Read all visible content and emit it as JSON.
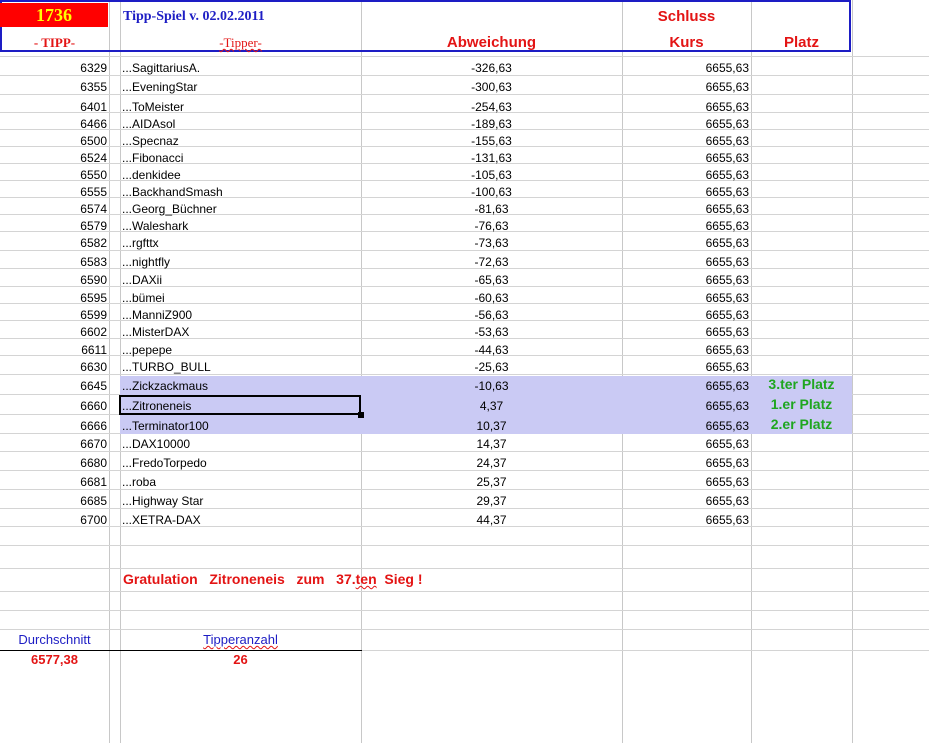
{
  "header": {
    "badge_number": "1736",
    "title": "Tipp-Spiel v. 02.02.2011",
    "col_tipp": "- TIPP-",
    "col_tipper": "-Tipper-",
    "col_abweichung": "Abweichung",
    "col_schluss": "Schluss",
    "col_kurs": "Kurs",
    "col_platz": "Platz"
  },
  "rows": [
    {
      "tipp": "6329",
      "tipper": "...SagittariusA.",
      "abw": "-326,63",
      "kurs": "6655,63",
      "platz": ""
    },
    {
      "tipp": "6355",
      "tipper": "...EveningStar",
      "abw": "-300,63",
      "kurs": "6655,63",
      "platz": ""
    },
    {
      "tipp": "6401",
      "tipper": "...ToMeister",
      "abw": "-254,63",
      "kurs": "6655,63",
      "platz": ""
    },
    {
      "tipp": "6466",
      "tipper": "...AIDAsol",
      "abw": "-189,63",
      "kurs": "6655,63",
      "platz": ""
    },
    {
      "tipp": "6500",
      "tipper": "...Specnaz",
      "abw": "-155,63",
      "kurs": "6655,63",
      "platz": ""
    },
    {
      "tipp": "6524",
      "tipper": "...Fibonacci",
      "abw": "-131,63",
      "kurs": "6655,63",
      "platz": ""
    },
    {
      "tipp": "6550",
      "tipper": "...denkidee",
      "abw": "-105,63",
      "kurs": "6655,63",
      "platz": ""
    },
    {
      "tipp": "6555",
      "tipper": "...BackhandSmash",
      "abw": "-100,63",
      "kurs": "6655,63",
      "platz": ""
    },
    {
      "tipp": "6574",
      "tipper": "...Georg_Büchner",
      "abw": "-81,63",
      "kurs": "6655,63",
      "platz": ""
    },
    {
      "tipp": "6579",
      "tipper": "...Waleshark",
      "abw": "-76,63",
      "kurs": "6655,63",
      "platz": ""
    },
    {
      "tipp": "6582",
      "tipper": "...rgfttx",
      "abw": "-73,63",
      "kurs": "6655,63",
      "platz": ""
    },
    {
      "tipp": "6583",
      "tipper": "...nightfly",
      "abw": "-72,63",
      "kurs": "6655,63",
      "platz": ""
    },
    {
      "tipp": "6590",
      "tipper": "...DAXii",
      "abw": "-65,63",
      "kurs": "6655,63",
      "platz": ""
    },
    {
      "tipp": "6595",
      "tipper": "...bümei",
      "abw": "-60,63",
      "kurs": "6655,63",
      "platz": ""
    },
    {
      "tipp": "6599",
      "tipper": "...ManniZ900",
      "abw": "-56,63",
      "kurs": "6655,63",
      "platz": ""
    },
    {
      "tipp": "6602",
      "tipper": "...MisterDAX",
      "abw": "-53,63",
      "kurs": "6655,63",
      "platz": ""
    },
    {
      "tipp": "6611",
      "tipper": "...pepepe",
      "abw": "-44,63",
      "kurs": "6655,63",
      "platz": ""
    },
    {
      "tipp": "6630",
      "tipper": "...TURBO_BULL",
      "abw": "-25,63",
      "kurs": "6655,63",
      "platz": ""
    },
    {
      "tipp": "6645",
      "tipper": "...Zickzackmaus",
      "abw": "-10,63",
      "kurs": "6655,63",
      "platz": "3.ter Platz"
    },
    {
      "tipp": "6660",
      "tipper": "...Zitroneneis",
      "abw": "4,37",
      "kurs": "6655,63",
      "platz": "1.er Platz"
    },
    {
      "tipp": "6666",
      "tipper": "...Terminator100",
      "abw": "10,37",
      "kurs": "6655,63",
      "platz": "2.er Platz"
    },
    {
      "tipp": "6670",
      "tipper": "...DAX10000",
      "abw": "14,37",
      "kurs": "6655,63",
      "platz": ""
    },
    {
      "tipp": "6680",
      "tipper": "...FredoTorpedo",
      "abw": "24,37",
      "kurs": "6655,63",
      "platz": ""
    },
    {
      "tipp": "6681",
      "tipper": "...roba",
      "abw": "25,37",
      "kurs": "6655,63",
      "platz": ""
    },
    {
      "tipp": "6685",
      "tipper": "...Highway Star",
      "abw": "29,37",
      "kurs": "6655,63",
      "platz": ""
    },
    {
      "tipp": "6700",
      "tipper": "...XETRA-DAX",
      "abw": "44,37",
      "kurs": "6655,63",
      "platz": ""
    }
  ],
  "congrats": {
    "gratulation": "Gratulation",
    "winner": "Zitroneneis",
    "zum": "zum",
    "count": "37.",
    "suffix": "ten",
    "end": "Sieg !"
  },
  "summary": {
    "avg_label": "Durchschnitt",
    "avg_value": "6577,38",
    "count_label": "Tipperanzahl",
    "count_value": "26"
  },
  "colors": {
    "header_border": "#1d1dc4",
    "badge_bg": "#ff0000",
    "badge_text": "#ffff00",
    "header_red": "#e31414",
    "highlight_bg": "#cacaf4",
    "rank_green": "#1fa61f",
    "title_blue": "#1d1dc4"
  }
}
